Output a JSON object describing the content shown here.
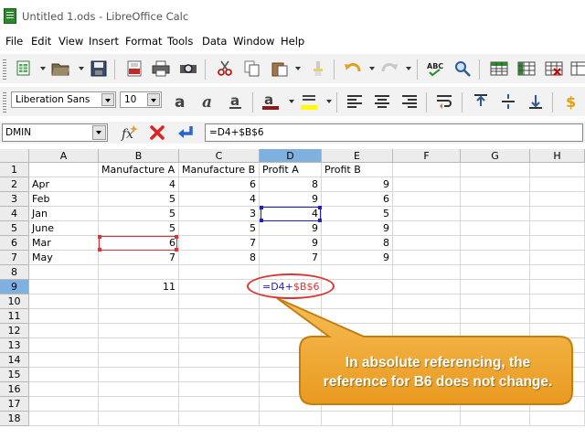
{
  "window": {
    "title": "Untitled 1.ods - LibreOffice Calc"
  },
  "menu": [
    "File",
    "Edit",
    "View",
    "Insert",
    "Format",
    "Tools",
    "Data",
    "Window",
    "Help"
  ],
  "toolbar": {
    "font_name": "Liberation Sans",
    "font_size": "10",
    "font_color": "#8b1a1a",
    "highlight_color": "#ffff00"
  },
  "formula_bar": {
    "name_box": "DMIN",
    "formula": "=D4+$B$6"
  },
  "sheet": {
    "columns": [
      "A",
      "B",
      "C",
      "D",
      "E",
      "F",
      "G",
      "H"
    ],
    "active_column": "D",
    "active_row": "9",
    "rows": [
      "1",
      "2",
      "3",
      "4",
      "5",
      "6",
      "7",
      "8",
      "9",
      "10",
      "11",
      "12",
      "13",
      "14",
      "15",
      "16",
      "17",
      "18"
    ],
    "cells": [
      [
        "",
        "Manufacture A",
        "Manufacture B",
        "Profit A",
        "Profit B"
      ],
      [
        "Apr",
        "4",
        "6",
        "8",
        "9"
      ],
      [
        "Feb",
        "5",
        "4",
        "9",
        "6"
      ],
      [
        "Jan",
        "5",
        "3",
        "4",
        "5"
      ],
      [
        "June",
        "5",
        "5",
        "9",
        "9"
      ],
      [
        "Mar",
        "6",
        "7",
        "9",
        "8"
      ],
      [
        "May",
        "7",
        "8",
        "7",
        "9"
      ],
      [
        "",
        "",
        "",
        "",
        ""
      ],
      [
        "",
        "11",
        "",
        "",
        ""
      ]
    ],
    "editing_formula": {
      "relative": "=D4+",
      "absolute": "$B$6"
    },
    "ref_colors": {
      "relative": "#2020c0",
      "absolute": "#e03030"
    }
  },
  "callout": {
    "line1": "In absolute referencing, the",
    "line2": "reference for B6 does not change.",
    "fill": "#f0a832",
    "border": "#c47e10"
  }
}
